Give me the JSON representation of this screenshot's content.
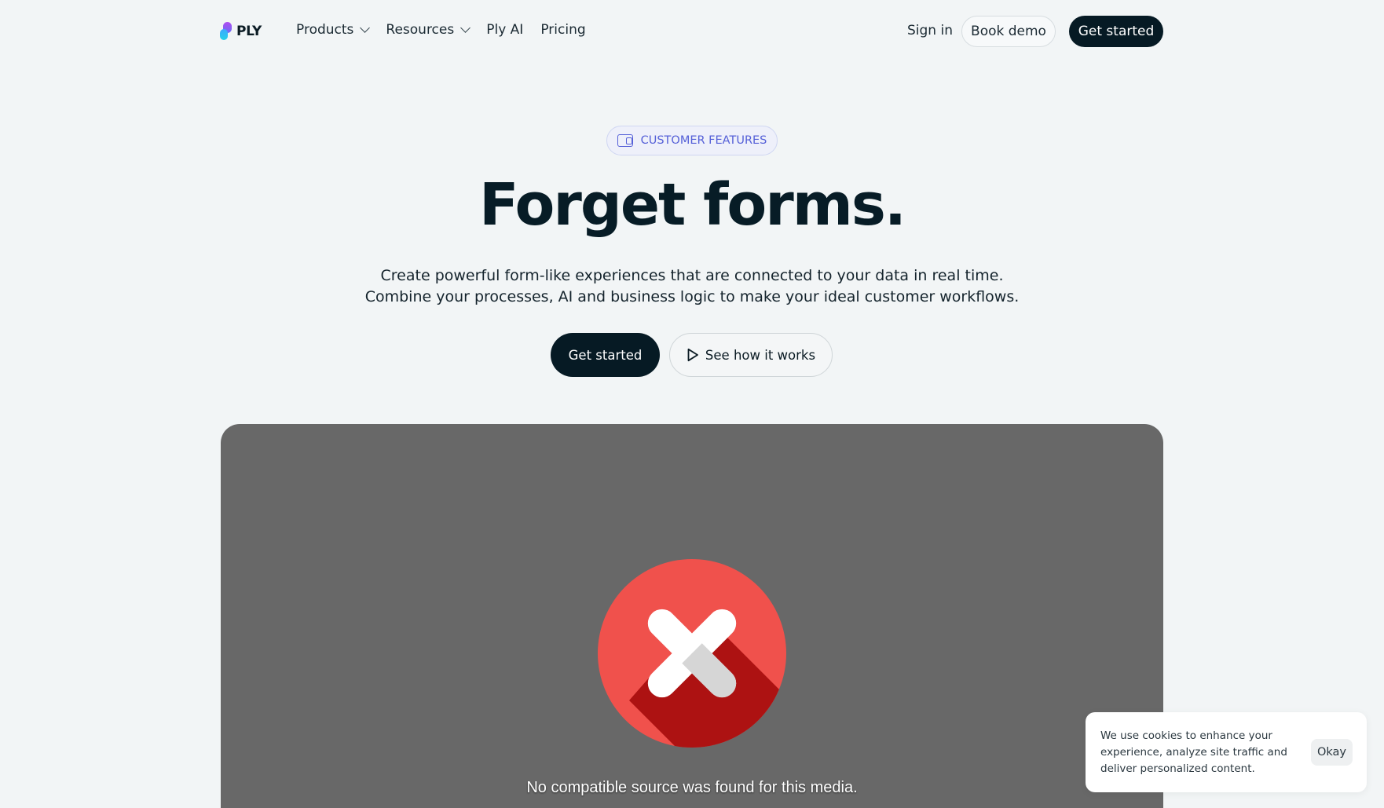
{
  "nav": {
    "logo_text": "PLY",
    "links": [
      {
        "label": "Products",
        "has_dropdown": true
      },
      {
        "label": "Resources",
        "has_dropdown": true
      },
      {
        "label": "Ply AI",
        "has_dropdown": false
      },
      {
        "label": "Pricing",
        "has_dropdown": false
      }
    ],
    "sign_in": "Sign in",
    "book_demo": "Book demo",
    "get_started": "Get started"
  },
  "hero": {
    "badge": "CUSTOMER FEATURES",
    "title": "Forget forms.",
    "subtitle_line1": "Create powerful form-like experiences that are connected to your data in real time.",
    "subtitle_line2": "Combine your processes, AI and business logic to make your ideal customer workflows.",
    "cta_primary": "Get started",
    "cta_secondary": "See how it works"
  },
  "media": {
    "error_message": "No compatible source was found for this media.",
    "error_icon": "error-x-icon"
  },
  "cookie": {
    "text": "We use cookies to enhance your experience, analyze site traffic and deliver personalized content.",
    "ok_label": "Okay"
  },
  "colors": {
    "background": "#f2f5f6",
    "primary_dark": "#061a24",
    "badge_accent": "#5560d8",
    "media_bg": "#686868",
    "error_red": "#f0514c"
  }
}
